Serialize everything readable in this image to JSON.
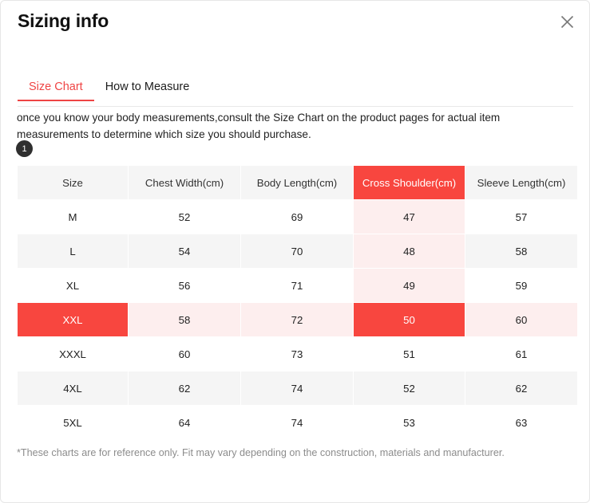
{
  "modal": {
    "title": "Sizing info",
    "close_icon": "close-icon"
  },
  "tabs": [
    {
      "label": "Size Chart",
      "active": true
    },
    {
      "label": "How to Measure",
      "active": false
    }
  ],
  "description": "once you know your body measurements,consult the Size Chart on the product pages for actual item measurements to determine which size you should purchase.",
  "badge": {
    "label": "1"
  },
  "footnote": "*These charts are for reference only. Fit may vary depending on the construction, materials and manufacturer.",
  "colors": {
    "accent_red": "#f8463f",
    "tab_active": "#ef4444",
    "highlight_pink": "#fdeeee",
    "row_alt": "#f5f5f5",
    "header_bg": "#f5f5f5",
    "badge_bg": "#2f2f2f",
    "footnote_text": "#8c8c8c"
  },
  "table": {
    "headers": [
      "Size",
      "Chest Width(cm)",
      "Body Length(cm)",
      "Cross Shoulder(cm)",
      "Sleeve Length(cm)"
    ],
    "highlighted_column_index": 3,
    "selected_row_index": 3,
    "rows": [
      {
        "size": "M",
        "chest": "52",
        "body": "69",
        "shoulder": "47",
        "sleeve": "57"
      },
      {
        "size": "L",
        "chest": "54",
        "body": "70",
        "shoulder": "48",
        "sleeve": "58"
      },
      {
        "size": "XL",
        "chest": "56",
        "body": "71",
        "shoulder": "49",
        "sleeve": "59"
      },
      {
        "size": "XXL",
        "chest": "58",
        "body": "72",
        "shoulder": "50",
        "sleeve": "60"
      },
      {
        "size": "XXXL",
        "chest": "60",
        "body": "73",
        "shoulder": "51",
        "sleeve": "61"
      },
      {
        "size": "4XL",
        "chest": "62",
        "body": "74",
        "shoulder": "52",
        "sleeve": "62"
      },
      {
        "size": "5XL",
        "chest": "64",
        "body": "74",
        "shoulder": "53",
        "sleeve": "63"
      }
    ]
  }
}
